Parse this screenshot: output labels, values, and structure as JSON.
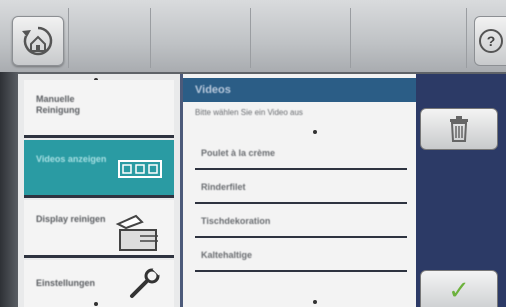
{
  "header": {
    "home_icon": "home-back-icon",
    "help_label": "?"
  },
  "sidebar": {
    "items": [
      {
        "label": "Manuelle Reinigung",
        "icon": ""
      },
      {
        "label": "Videos anzeigen",
        "icon": "film-strip-icon",
        "active": true
      },
      {
        "label": "Display reinigen",
        "icon": "display-clean-icon"
      },
      {
        "label": "Einstellungen",
        "icon": "wrench-icon"
      }
    ]
  },
  "main": {
    "title": "Videos",
    "instruction": "Bitte wählen Sie ein Video aus",
    "items": [
      {
        "label": "Poulet à la crème"
      },
      {
        "label": "Rinderfilet"
      },
      {
        "label": "Tischdekoration"
      },
      {
        "label": "Kaltehaltige"
      }
    ]
  },
  "colors": {
    "active_item": "#2a9ba3",
    "title_bar": "#2b5d86",
    "right_panel": "#2c3a66",
    "confirm_check": "#6db23d"
  }
}
